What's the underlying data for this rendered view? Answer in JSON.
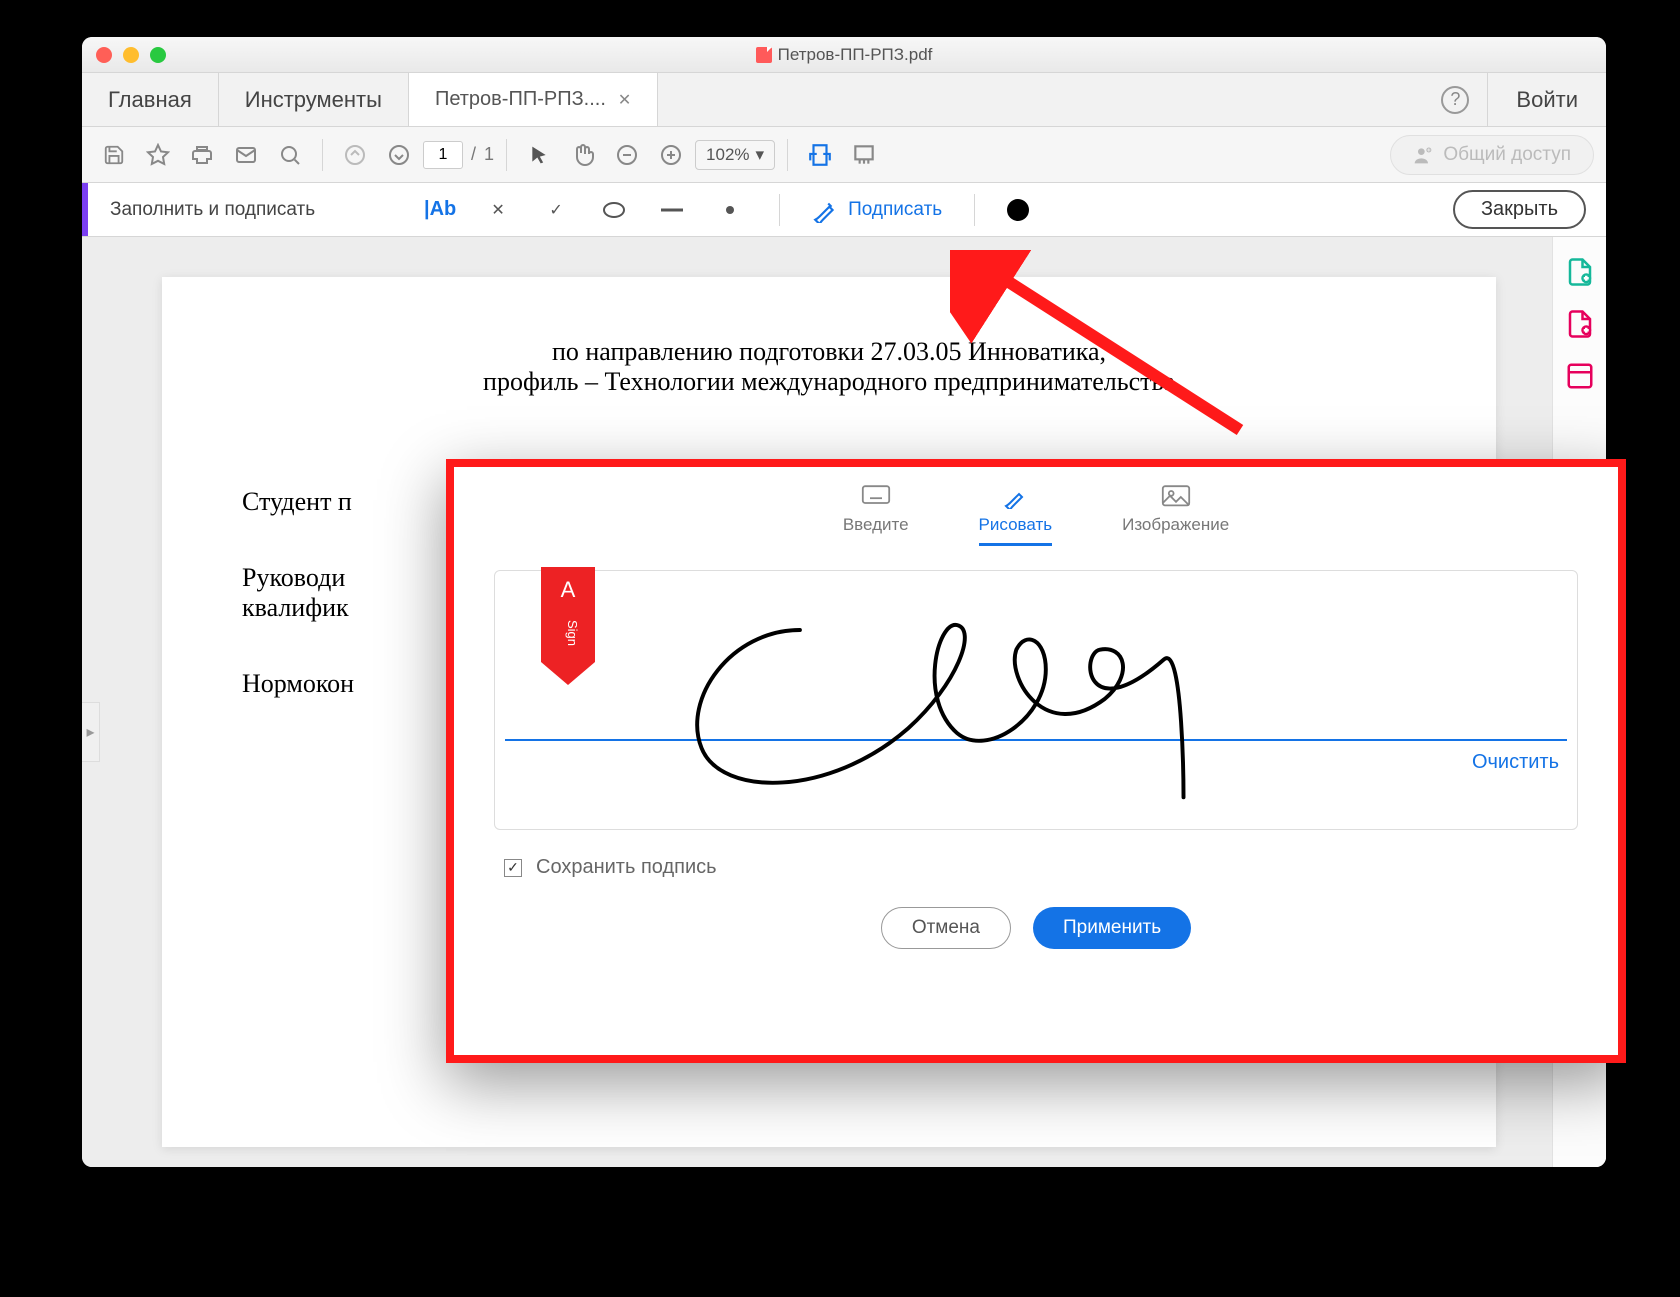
{
  "titlebar": {
    "filename": "Петров-ПП-РПЗ.pdf"
  },
  "tabs": {
    "home": "Главная",
    "tools": "Инструменты",
    "doc": "Петров-ПП-РПЗ....",
    "login": "Войти"
  },
  "toolbar": {
    "page_current": "1",
    "page_sep": "/",
    "page_total": "1",
    "zoom": "102%",
    "share": "Общий доступ"
  },
  "fillbar": {
    "title": "Заполнить и подписать",
    "text_tool": "|Ab",
    "sign": "Подписать",
    "close": "Закрыть"
  },
  "document": {
    "line1": "по направлению подготовки 27.03.05 Инноватика,",
    "line2": "профиль – Технологии международного предпринимательства",
    "student": "Студент п",
    "supervisor1": "Руководи",
    "supervisor2": "квалифик",
    "norm": "Нормокон"
  },
  "dialog": {
    "tabs": {
      "type": "Введите",
      "draw": "Рисовать",
      "image": "Изображение"
    },
    "clear": "Очистить",
    "ribbon": "Sign",
    "save_signature": "Сохранить подпись",
    "cancel": "Отмена",
    "apply": "Применить",
    "save_checked": true
  }
}
